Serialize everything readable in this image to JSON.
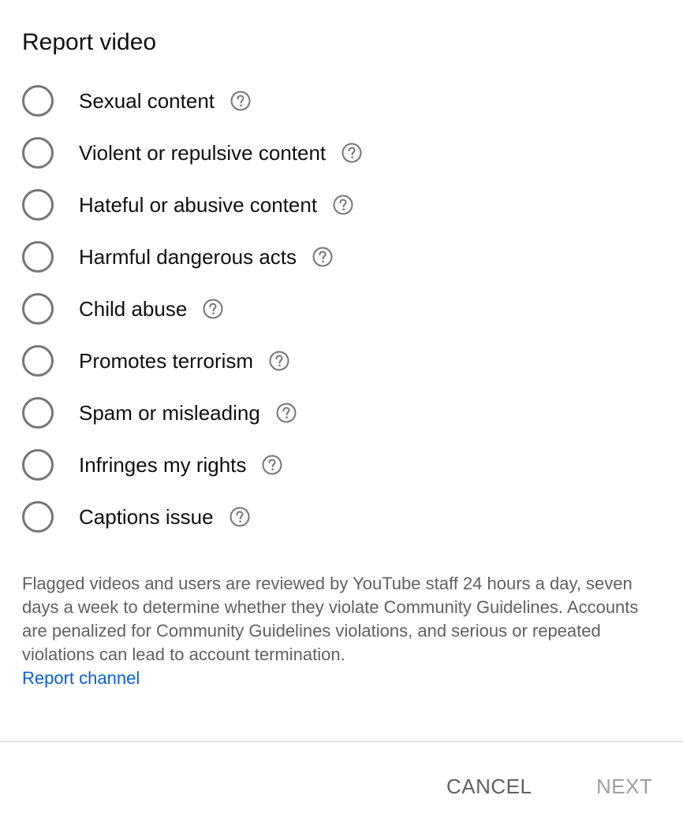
{
  "dialog": {
    "title": "Report video",
    "options": [
      {
        "label": "Sexual content"
      },
      {
        "label": "Violent or repulsive content"
      },
      {
        "label": "Hateful or abusive content"
      },
      {
        "label": "Harmful dangerous acts"
      },
      {
        "label": "Child abuse"
      },
      {
        "label": "Promotes terrorism"
      },
      {
        "label": "Spam or misleading"
      },
      {
        "label": "Infringes my rights"
      },
      {
        "label": "Captions issue"
      }
    ],
    "info_text": "Flagged videos and users are reviewed by YouTube staff 24 hours a day, seven days a week to determine whether they violate Community Guidelines. Accounts are penalized for Community Guidelines violations, and serious or repeated violations can lead to account termination.",
    "report_channel_link": "Report channel",
    "cancel_label": "CANCEL",
    "next_label": "NEXT"
  },
  "icons": {
    "radio": "radio-unchecked-icon",
    "help": "help-circle-icon"
  },
  "colors": {
    "link": "#065fd4",
    "secondary_text": "#606060",
    "disabled_text": "#9e9e9e",
    "radio_border": "#757575"
  }
}
